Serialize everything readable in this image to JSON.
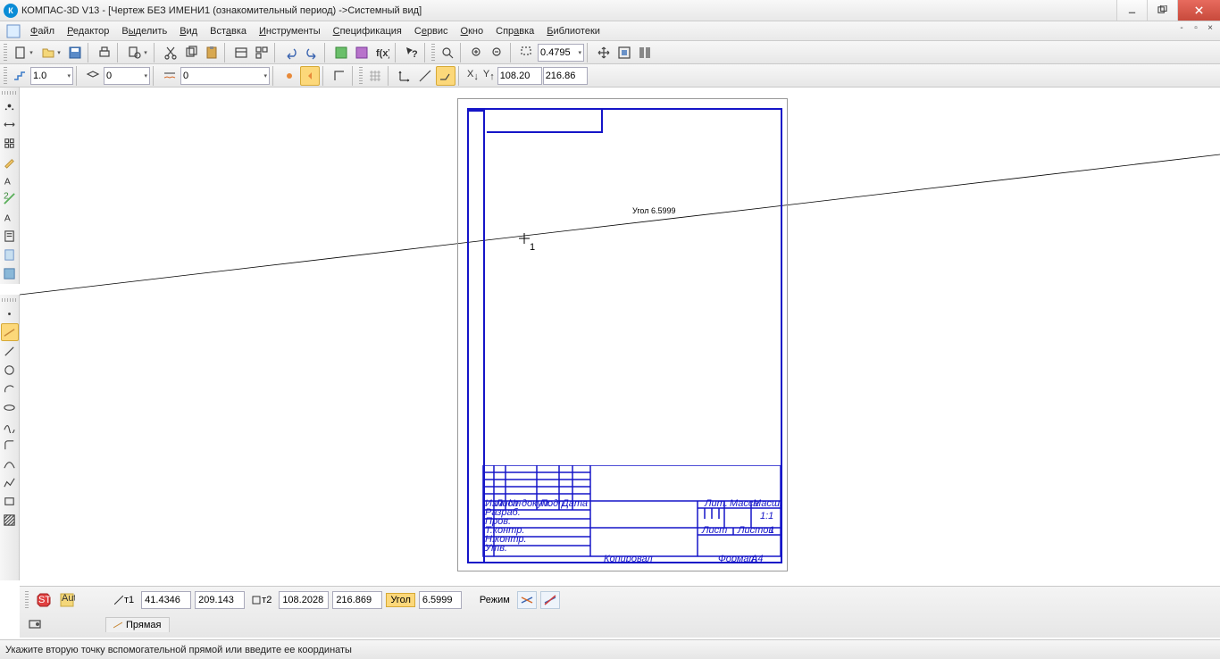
{
  "title": "КОМПАС-3D V13 - [Чертеж БЕЗ ИМЕНИ1 (ознакомительный период) ->Системный вид]",
  "menu": {
    "file": "Файл",
    "editor": "Редактор",
    "select": "Выделить",
    "view": "Вид",
    "insert": "Вставка",
    "tools": "Инструменты",
    "spec": "Спецификация",
    "service": "Сервис",
    "window": "Окно",
    "help": "Справка",
    "libs": "Библиотеки"
  },
  "tb2": {
    "zoom": "0.4795",
    "scale": "1.0",
    "layer": "0",
    "style": "0",
    "xlabel": "X+",
    "ylabel": "Y+",
    "x": "108.20",
    "y": "216.86"
  },
  "canvas": {
    "angle_label": "Угол 6.5999",
    "cursor_label": "1",
    "scale_hint": "11"
  },
  "titleblock": {
    "lit": "Лит.",
    "mass": "Масса",
    "scale": "Масштаб",
    "sheet": "Лист",
    "sheets": "Листов",
    "t": "1",
    "r1": "Изм.",
    "r2": "Лист",
    "r3": "№ докум.",
    "r4": "Подп.",
    "r5": "Дата",
    "row_razrab": "Разраб.",
    "row_prov": "Пров.",
    "row_tcontr": "Т.контр.",
    "row_ncontr": "Н.контр.",
    "row_utv": "Утв.",
    "kopiroval": "Копировал",
    "format": "Формат",
    "fmt": "A4"
  },
  "prop": {
    "t1": "т1",
    "x1": "41.4346",
    "y1": "209.143",
    "t2": "т2",
    "x2": "108.2028",
    "y2": "216.869",
    "angle_lbl": "Угол",
    "angle": "6.5999",
    "mode": "Режим",
    "tab": "Прямая"
  },
  "status": "Укажите вторую точку вспомогательной прямой или введите ее координаты"
}
